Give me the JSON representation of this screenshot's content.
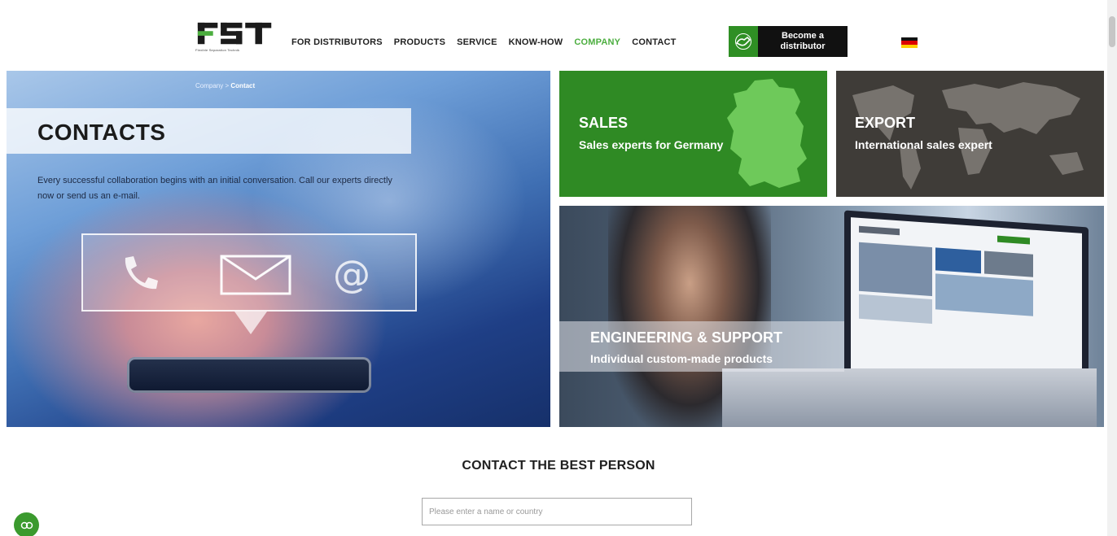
{
  "header": {
    "logo": {
      "letters": "FST",
      "tagline": "Flexible Separation Technik"
    },
    "nav": [
      {
        "label": "FOR DISTRIBUTORS",
        "active": false
      },
      {
        "label": "PRODUCTS",
        "active": false
      },
      {
        "label": "SERVICE",
        "active": false
      },
      {
        "label": "KNOW-HOW",
        "active": false
      },
      {
        "label": "COMPANY",
        "active": true
      },
      {
        "label": "CONTACT",
        "active": false
      }
    ],
    "cta": {
      "label_line1": "Become a",
      "label_line2": "distributor",
      "icon": "handshake-icon"
    },
    "language_flag": "de-flag"
  },
  "hero": {
    "breadcrumb": {
      "parent": "Company",
      "separator": ">",
      "current": "Contact"
    },
    "title": "CONTACTS",
    "description": "Every successful collaboration begins with an initial conversation. Call our experts directly now or send us an e-mail.",
    "icons": [
      "phone-icon",
      "envelope-icon",
      "at-icon"
    ]
  },
  "tiles": {
    "sales": {
      "title": "SALES",
      "subtitle": "Sales experts for Germany"
    },
    "export": {
      "title": "EXPORT",
      "subtitle": "International sales expert"
    },
    "engineering": {
      "title": "ENGINEERING & SUPPORT",
      "subtitle": "Individual custom-made products"
    }
  },
  "contact_section": {
    "title": "CONTACT THE BEST PERSON",
    "search_placeholder": "Please enter a name or country"
  },
  "colors": {
    "brand_green": "#2f8a24",
    "nav_active": "#4cae3f",
    "export_grey": "#3f3c38",
    "cta_black": "#111111"
  }
}
